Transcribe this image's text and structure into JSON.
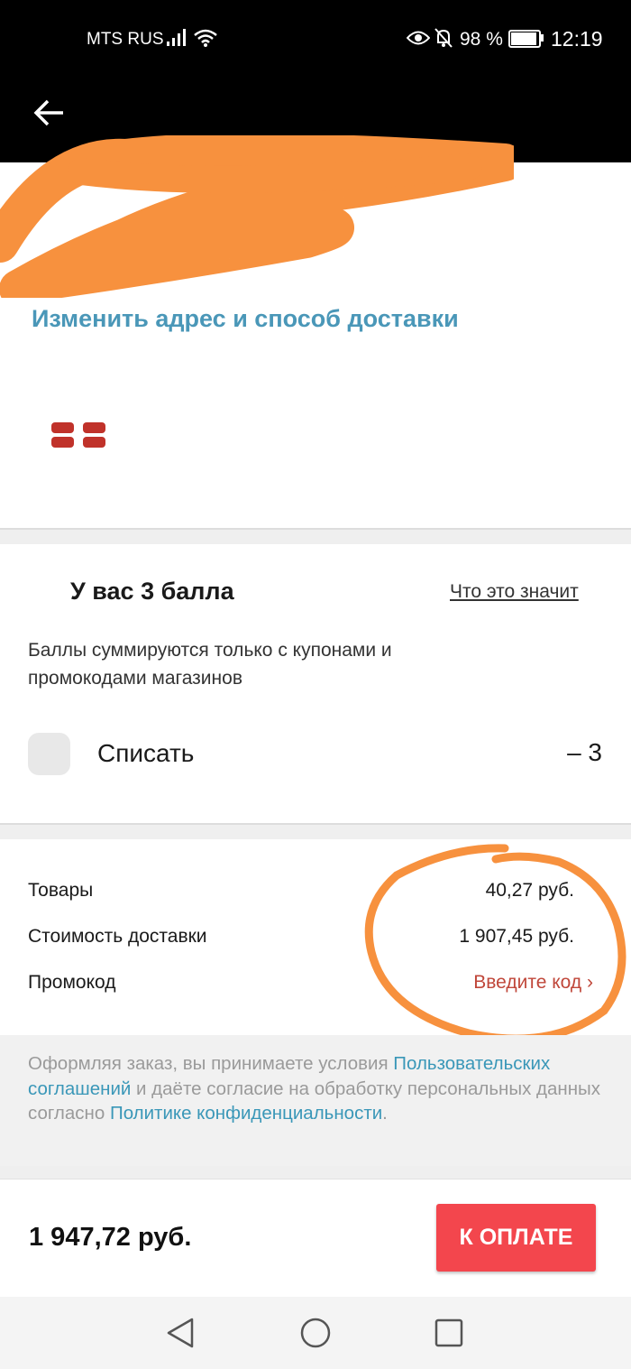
{
  "status_bar": {
    "carrier": "MTS RUS",
    "battery": "98 %",
    "time": "12:19",
    "icons": [
      "signal-icon",
      "wifi-icon",
      "eye-icon",
      "bell-off-icon",
      "battery-icon"
    ]
  },
  "address": {
    "change_link": "Изменить адрес и способ доставки"
  },
  "points": {
    "title": "У вас 3 балла",
    "what_link": "Что это значит",
    "description": "Баллы суммируются только с купонами и промокодами магазинов",
    "writeoff_label": "Списать",
    "writeoff_value": "– 3"
  },
  "summary": {
    "goods_label": "Товары",
    "goods_value": "40,27 руб.",
    "delivery_label": "Стоимость доставки",
    "delivery_value": "1 907,45 руб.",
    "promo_label": "Промокод",
    "promo_link": "Введите код"
  },
  "legal": {
    "part1": "Оформляя заказ, вы принимаете условия ",
    "link1": "Пользовательских соглашений",
    "part2": " и даёте согласие на обработку персональных данных согласно ",
    "link2": "Политике конфиденциальности",
    "part3": "."
  },
  "footer": {
    "total": "1 947,72 руб.",
    "pay_button": "К ОПЛАТЕ"
  },
  "colors": {
    "accent_link": "#4a97b8",
    "pay_button": "#f3464d",
    "promo_link": "#c0473a",
    "annotation": "#f7913e"
  }
}
